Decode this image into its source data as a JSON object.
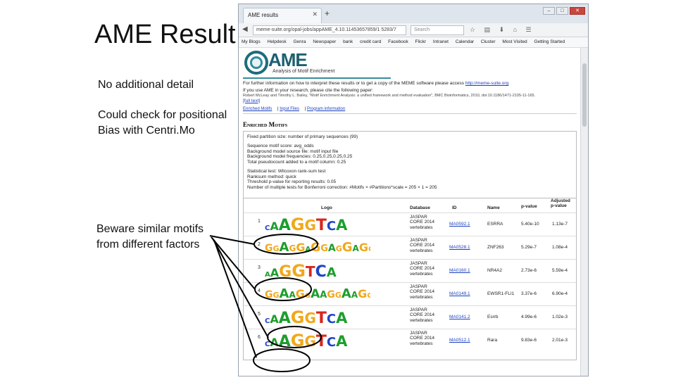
{
  "slide": {
    "title": "AME Result",
    "note1": "No additional detail",
    "note2_line1": "Could check for positional",
    "note2_line2": "Bias with Centri.Mo",
    "note3_line1": "Beware similar motifs",
    "note3_line2": "from different factors"
  },
  "browser": {
    "tab_title": "AME results",
    "url": "meme-suite.org/opal-jobs/appAME_4.10.11453657859/1 5283/7",
    "search_placeholder": "Search",
    "bookmarks": [
      "My Blogs",
      "Helpdesk",
      "Genra",
      "Newspaper",
      "bank",
      "credit card",
      "Facebook",
      "Flickr",
      "Intranet",
      "Calendar",
      "Cluster",
      "Most Visited",
      "Getting Started"
    ]
  },
  "page": {
    "logo_word": "AME",
    "logo_subtitle": "Analysis of Motif Enrichment",
    "info_line": "For further information on how to interpret these results or to get a copy of the MEME software please access",
    "info_link": "http://meme-suite.org",
    "cite_intro": "If you use AME in your research, please cite the following paper:",
    "cite_text": "Robert McLeay and Timothy L. Bailey, \"Motif Enrichment Analysis: a unified framework and method evaluation\", BMC Bioinformatics, 2010, doi:10.1186/1471-2105-11-165.",
    "full_text": "[full text]",
    "nav_links": [
      "Enriched Motifs",
      "Input Files",
      "Program information"
    ],
    "section_title": "Enriched Motifs",
    "info_lines": [
      "Fixed partition size: number of primary sequences (99)",
      "",
      "Sequence motif score: avg_odds",
      "Background model source file: motif input file",
      "Background model frequencies: 0.25,0.25,0.25,0.25",
      "Total pseudocount added to a motif column: 0.25",
      "",
      "Statistical test: Wilcoxon rank-sum test",
      "Ranksum method: quick",
      "Threshold p-value for reporting results: 0.05",
      "Number of multiple tests for Bonferroni correction: #Motifs × #Partitions*scale = 205 × 1 = 205"
    ]
  },
  "table": {
    "headers": {
      "logo": "Logo",
      "database": "Database",
      "id": "ID",
      "name": "Name",
      "pvalue": "p-value",
      "adj1": "Adjusted",
      "adj2": "p-value"
    },
    "rows": [
      {
        "num": "1",
        "db1": "JASPAR",
        "db2": "CORE 2014",
        "db3": "vertebrates",
        "id": "MA0592.1",
        "name": "ESRRA",
        "p": "5.40e-10",
        "adj": "1.13e-7",
        "logo": "CAAGGTCA"
      },
      {
        "num": "2",
        "db1": "JASPAR",
        "db2": "CORE 2014",
        "db3": "vertebrates",
        "id": "MA0528.1",
        "name": "ZNF263",
        "p": "5.29e-7",
        "adj": "1.08e-4",
        "logo": "GGAGGAGGAGGAGGAG"
      },
      {
        "num": "3",
        "db1": "JASPAR",
        "db2": "CORE 2014",
        "db3": "vertebrates",
        "id": "MA0160.1",
        "name": "NR4A2",
        "p": "2.73e-6",
        "adj": "5.59e-4",
        "logo": "AAGGTCA"
      },
      {
        "num": "4",
        "db1": "JASPAR",
        "db2": "CORE 2014",
        "db3": "vertebrates",
        "id": "MA0149.1",
        "name": "EWSR1-FLI1",
        "p": "3.37e-6",
        "adj": "6.90e-4",
        "logo": "GGAAGGAAGGAAGGAAGG"
      },
      {
        "num": "5",
        "db1": "JASPAR",
        "db2": "CORE 2014",
        "db3": "vertebrates",
        "id": "MA0141.2",
        "name": "Esrrb",
        "p": "4.99e-6",
        "adj": "1.02e-3",
        "logo": "CAAGGTCA"
      },
      {
        "num": "6",
        "db1": "JASPAR",
        "db2": "CORE 2014",
        "db3": "vertebrates",
        "id": "MA0512.1",
        "name": "Rara",
        "p": "9.83e-6",
        "adj": "2.01e-3",
        "logo": "CAAGGTCA"
      }
    ]
  },
  "colors": {
    "A": "#1c9e2c",
    "C": "#1f44c6",
    "G": "#f0a81c",
    "T": "#d8261e",
    "ame_brand": "#1d5f70"
  }
}
